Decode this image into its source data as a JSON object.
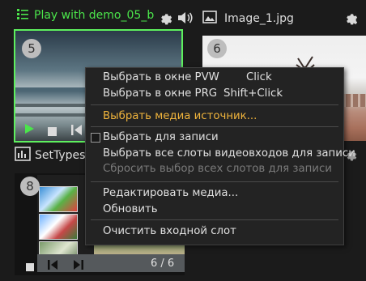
{
  "left_panel": {
    "title": "Play with demo_05_b",
    "slot_number": "5",
    "icons": [
      "list-icon",
      "gear-icon",
      "speaker-icon"
    ],
    "controls": [
      "play-icon",
      "stop-icon",
      "skip-back-icon"
    ],
    "accent_color": "#4be54b"
  },
  "right_panel": {
    "title": "Image_1.jpg",
    "slot_number": "6",
    "icons": [
      "image-icon",
      "gear-icon"
    ]
  },
  "bottom_panel": {
    "title": "SetTypes.",
    "slot_number": "8",
    "counter": "6 / 6",
    "icons": [
      "waveform-icon",
      "gear-icon"
    ],
    "controls": [
      "stop-icon",
      "skip-back-icon",
      "skip-forward-icon"
    ]
  },
  "context_menu": {
    "items": [
      {
        "label": "Выбрать в окне PVW",
        "shortcut": "Click",
        "state": "normal"
      },
      {
        "label": "Выбрать в окне PRG",
        "shortcut": "Shift+Click",
        "state": "normal"
      },
      {
        "label": "Выбрать медиа источник...",
        "state": "highlighted"
      },
      {
        "label": "Выбрать для записи",
        "state": "checkbox"
      },
      {
        "label": "Выбрать все слоты видеовходов для записи",
        "state": "normal"
      },
      {
        "label": "Сбросить выбор всех слотов для записи",
        "state": "disabled"
      },
      {
        "label": "Редактировать медиа...",
        "state": "normal"
      },
      {
        "label": "Обновить",
        "state": "normal"
      },
      {
        "label": "Очистить входной слот",
        "state": "normal"
      }
    ],
    "highlight_color": "#f0b43c",
    "disabled_color": "#7a7a7a"
  }
}
